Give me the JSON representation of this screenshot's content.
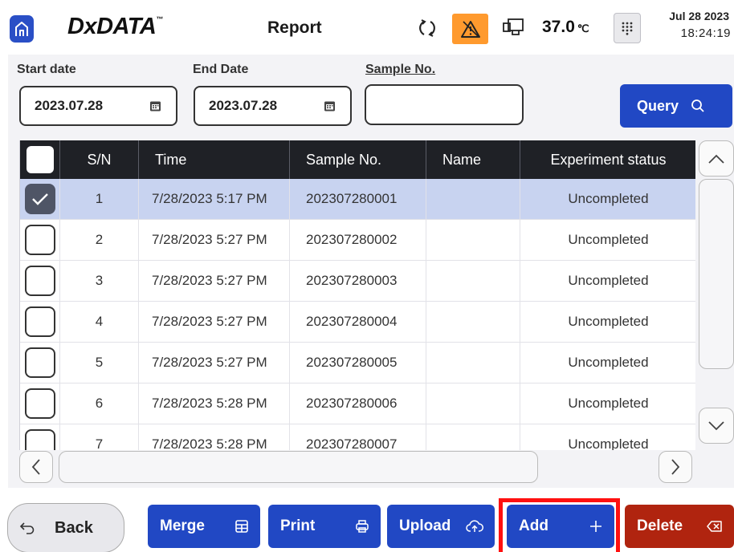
{
  "header": {
    "home_icon": "home-icon",
    "logo_text": "DxDATA",
    "logo_tm": "™",
    "title": "Report",
    "sync_icon": "sync-icon",
    "alarm_icon": "warning-icon",
    "device_icon": "device-icon",
    "temperature": "37.0",
    "temperature_unit": "℃",
    "keypad_icon": "keypad-icon",
    "date": "Jul 28 2023",
    "time": "18:24:19",
    "colors": {
      "accent_blue": "#2148c4",
      "alarm_orange": "#ff9a2e"
    }
  },
  "filters": {
    "start_date_label": "Start date",
    "start_date_value": "2023.07.28",
    "end_date_label": "End Date",
    "end_date_value": "2023.07.28",
    "sample_no_label": "Sample No.",
    "sample_no_value": "",
    "query_label": "Query",
    "calendar_icon": "calendar-icon",
    "query_icon": "search-icon"
  },
  "table": {
    "columns": [
      "",
      "S/N",
      "Time",
      "Sample No.",
      "Name",
      "Experiment status"
    ],
    "rows": [
      {
        "checked": true,
        "sn": "1",
        "time": "7/28/2023 5:17 PM",
        "sample_no": "202307280001",
        "name": "",
        "status": "Uncompleted"
      },
      {
        "checked": false,
        "sn": "2",
        "time": "7/28/2023 5:27 PM",
        "sample_no": "202307280002",
        "name": "",
        "status": "Uncompleted"
      },
      {
        "checked": false,
        "sn": "3",
        "time": "7/28/2023 5:27 PM",
        "sample_no": "202307280003",
        "name": "",
        "status": "Uncompleted"
      },
      {
        "checked": false,
        "sn": "4",
        "time": "7/28/2023 5:27 PM",
        "sample_no": "202307280004",
        "name": "",
        "status": "Uncompleted"
      },
      {
        "checked": false,
        "sn": "5",
        "time": "7/28/2023 5:27 PM",
        "sample_no": "202307280005",
        "name": "",
        "status": "Uncompleted"
      },
      {
        "checked": false,
        "sn": "6",
        "time": "7/28/2023 5:28 PM",
        "sample_no": "202307280006",
        "name": "",
        "status": "Uncompleted"
      },
      {
        "checked": false,
        "sn": "7",
        "time": "7/28/2023 5:28 PM",
        "sample_no": "202307280007",
        "name": "",
        "status": "Uncompleted"
      }
    ],
    "selected_row_color": "#c8d3f0"
  },
  "footer": {
    "back_label": "Back",
    "merge_label": "Merge",
    "print_label": "Print",
    "upload_label": "Upload",
    "add_label": "Add",
    "delete_label": "Delete",
    "back_icon": "back-arrow-icon",
    "merge_icon": "merge-icon",
    "print_icon": "print-icon",
    "upload_icon": "cloud-upload-icon",
    "add_icon": "plus-icon",
    "delete_icon": "backspace-icon",
    "highlight_color": "#ff1010"
  }
}
